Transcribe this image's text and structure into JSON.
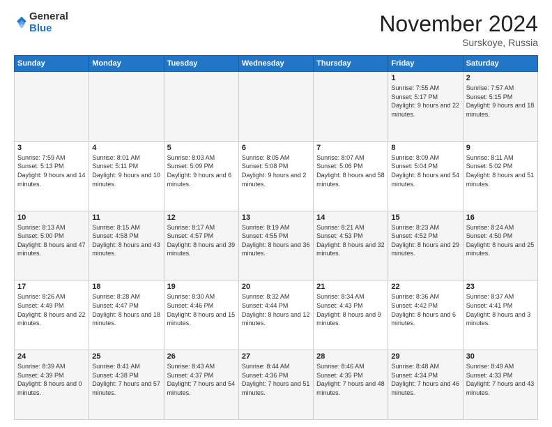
{
  "logo": {
    "general": "General",
    "blue": "Blue"
  },
  "header": {
    "month": "November 2024",
    "location": "Surskoye, Russia"
  },
  "days_of_week": [
    "Sunday",
    "Monday",
    "Tuesday",
    "Wednesday",
    "Thursday",
    "Friday",
    "Saturday"
  ],
  "weeks": [
    [
      {
        "day": "",
        "info": ""
      },
      {
        "day": "",
        "info": ""
      },
      {
        "day": "",
        "info": ""
      },
      {
        "day": "",
        "info": ""
      },
      {
        "day": "",
        "info": ""
      },
      {
        "day": "1",
        "info": "Sunrise: 7:55 AM\nSunset: 5:17 PM\nDaylight: 9 hours and 22 minutes."
      },
      {
        "day": "2",
        "info": "Sunrise: 7:57 AM\nSunset: 5:15 PM\nDaylight: 9 hours and 18 minutes."
      }
    ],
    [
      {
        "day": "3",
        "info": "Sunrise: 7:59 AM\nSunset: 5:13 PM\nDaylight: 9 hours and 14 minutes."
      },
      {
        "day": "4",
        "info": "Sunrise: 8:01 AM\nSunset: 5:11 PM\nDaylight: 9 hours and 10 minutes."
      },
      {
        "day": "5",
        "info": "Sunrise: 8:03 AM\nSunset: 5:09 PM\nDaylight: 9 hours and 6 minutes."
      },
      {
        "day": "6",
        "info": "Sunrise: 8:05 AM\nSunset: 5:08 PM\nDaylight: 9 hours and 2 minutes."
      },
      {
        "day": "7",
        "info": "Sunrise: 8:07 AM\nSunset: 5:06 PM\nDaylight: 8 hours and 58 minutes."
      },
      {
        "day": "8",
        "info": "Sunrise: 8:09 AM\nSunset: 5:04 PM\nDaylight: 8 hours and 54 minutes."
      },
      {
        "day": "9",
        "info": "Sunrise: 8:11 AM\nSunset: 5:02 PM\nDaylight: 8 hours and 51 minutes."
      }
    ],
    [
      {
        "day": "10",
        "info": "Sunrise: 8:13 AM\nSunset: 5:00 PM\nDaylight: 8 hours and 47 minutes."
      },
      {
        "day": "11",
        "info": "Sunrise: 8:15 AM\nSunset: 4:58 PM\nDaylight: 8 hours and 43 minutes."
      },
      {
        "day": "12",
        "info": "Sunrise: 8:17 AM\nSunset: 4:57 PM\nDaylight: 8 hours and 39 minutes."
      },
      {
        "day": "13",
        "info": "Sunrise: 8:19 AM\nSunset: 4:55 PM\nDaylight: 8 hours and 36 minutes."
      },
      {
        "day": "14",
        "info": "Sunrise: 8:21 AM\nSunset: 4:53 PM\nDaylight: 8 hours and 32 minutes."
      },
      {
        "day": "15",
        "info": "Sunrise: 8:23 AM\nSunset: 4:52 PM\nDaylight: 8 hours and 29 minutes."
      },
      {
        "day": "16",
        "info": "Sunrise: 8:24 AM\nSunset: 4:50 PM\nDaylight: 8 hours and 25 minutes."
      }
    ],
    [
      {
        "day": "17",
        "info": "Sunrise: 8:26 AM\nSunset: 4:49 PM\nDaylight: 8 hours and 22 minutes."
      },
      {
        "day": "18",
        "info": "Sunrise: 8:28 AM\nSunset: 4:47 PM\nDaylight: 8 hours and 18 minutes."
      },
      {
        "day": "19",
        "info": "Sunrise: 8:30 AM\nSunset: 4:46 PM\nDaylight: 8 hours and 15 minutes."
      },
      {
        "day": "20",
        "info": "Sunrise: 8:32 AM\nSunset: 4:44 PM\nDaylight: 8 hours and 12 minutes."
      },
      {
        "day": "21",
        "info": "Sunrise: 8:34 AM\nSunset: 4:43 PM\nDaylight: 8 hours and 9 minutes."
      },
      {
        "day": "22",
        "info": "Sunrise: 8:36 AM\nSunset: 4:42 PM\nDaylight: 8 hours and 6 minutes."
      },
      {
        "day": "23",
        "info": "Sunrise: 8:37 AM\nSunset: 4:41 PM\nDaylight: 8 hours and 3 minutes."
      }
    ],
    [
      {
        "day": "24",
        "info": "Sunrise: 8:39 AM\nSunset: 4:39 PM\nDaylight: 8 hours and 0 minutes."
      },
      {
        "day": "25",
        "info": "Sunrise: 8:41 AM\nSunset: 4:38 PM\nDaylight: 7 hours and 57 minutes."
      },
      {
        "day": "26",
        "info": "Sunrise: 8:43 AM\nSunset: 4:37 PM\nDaylight: 7 hours and 54 minutes."
      },
      {
        "day": "27",
        "info": "Sunrise: 8:44 AM\nSunset: 4:36 PM\nDaylight: 7 hours and 51 minutes."
      },
      {
        "day": "28",
        "info": "Sunrise: 8:46 AM\nSunset: 4:35 PM\nDaylight: 7 hours and 48 minutes."
      },
      {
        "day": "29",
        "info": "Sunrise: 8:48 AM\nSunset: 4:34 PM\nDaylight: 7 hours and 46 minutes."
      },
      {
        "day": "30",
        "info": "Sunrise: 8:49 AM\nSunset: 4:33 PM\nDaylight: 7 hours and 43 minutes."
      }
    ]
  ]
}
